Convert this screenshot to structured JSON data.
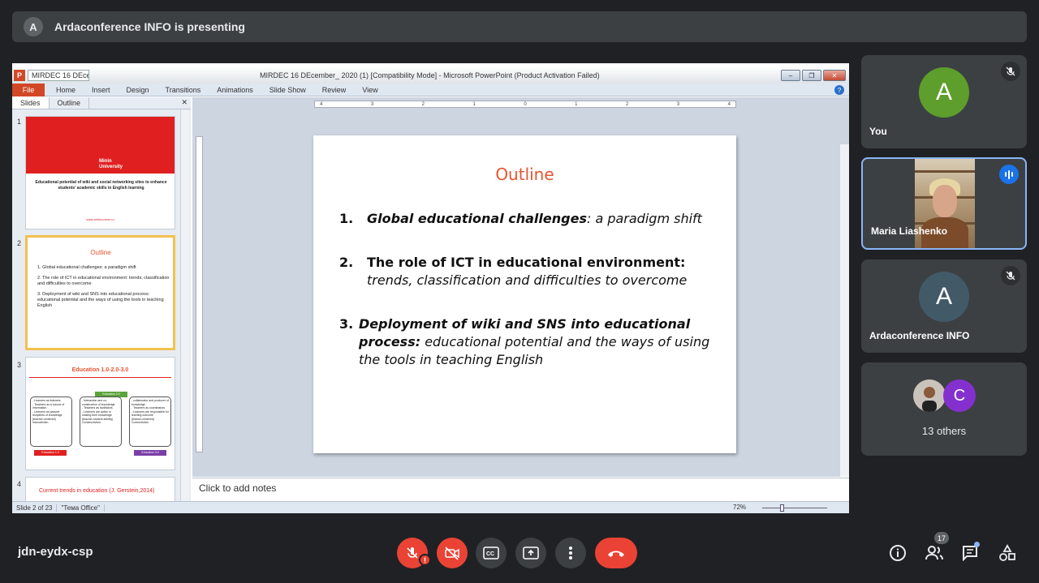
{
  "banner": {
    "avatar_letter": "A",
    "text": "Ardaconference INFO is presenting"
  },
  "powerpoint": {
    "doc_tab": "MIRDEC 16 DEcem",
    "window_title": "MIRDEC 16 DEcember_ 2020 (1) [Compatibility Mode] - Microsoft PowerPoint (Product Activation Failed)",
    "ribbon_tabs": [
      "File",
      "Home",
      "Insert",
      "Design",
      "Transitions",
      "Animations",
      "Slide Show",
      "Review",
      "View"
    ],
    "panel_tabs": [
      "Slides",
      "Outline"
    ],
    "thumbnails": {
      "t1": {
        "num": "1",
        "logo": "Minin\nUniversity",
        "text": "Educational potential of wiki and social networking sites to enhance students' academic skills in English learning",
        "foot": "www.mininuniver.ru"
      },
      "t2": {
        "num": "2",
        "title": "Outline",
        "items": [
          "1.  Global educational challenges: a paradigm shift",
          "2.  The role of ICT in educational environment: trends, classification and difficulties to overcome",
          "3.  Deployment of wiki and SNS into educational process: educational potential and the ways of using the tools in teaching English"
        ]
      },
      "t3": {
        "num": "3",
        "title": "Education 1.0-2.0-3.0",
        "tags": [
          "Education 1.0",
          "Education 2.0",
          "Education 3.0"
        ],
        "boxes": [
          "- Learners as listeners\n- Teachers as a source of information\n- Learners as passive recipients of knowledge\n(teacher-centered)\nInstructivism",
          "- Interaction and co-construction of knowledge\n- Teachers as facilitators\n- Learners are active in making their knowledge\n(teacher-student activity)\nConstructivism",
          "- collaborator and producer of knowledge\n- Teachers as coordinators\n- Learners are responsible for learning outcome\n(learner-centered)\nConnectivism"
        ]
      },
      "t4": {
        "num": "4",
        "title": "Current trends in education (J. Gerstein,2014)"
      }
    },
    "slide": {
      "title": "Outline",
      "items": [
        {
          "num": "1.",
          "bold": "Global educational challenges",
          "rest": ": a paradigm shift"
        },
        {
          "num": "2.",
          "bold": "The role of ICT in educational environment:",
          "rest": "trends, classification and difficulties to overcome"
        },
        {
          "num": "3.",
          "bold": "Deployment of wiki and SNS into educational process:",
          "rest": " educational potential and the ways of using the tools in teaching English"
        }
      ]
    },
    "notes_placeholder": "Click to add notes",
    "status": {
      "slide_of": "Slide 2 of 23",
      "theme": "\"Тема Office\"",
      "zoom": "72%"
    }
  },
  "participants": {
    "you": {
      "letter": "A",
      "name": "You",
      "color": "#5e9e2c"
    },
    "maria": {
      "name": "Maria Liashenko"
    },
    "arda": {
      "letter": "A",
      "name": "Ardaconference INFO",
      "color": "#425968"
    },
    "others": {
      "letter": "C",
      "label": "13 others",
      "color": "#8430ce"
    }
  },
  "bottom": {
    "meeting_code": "jdn-eydx-csp",
    "people_count": "17"
  }
}
